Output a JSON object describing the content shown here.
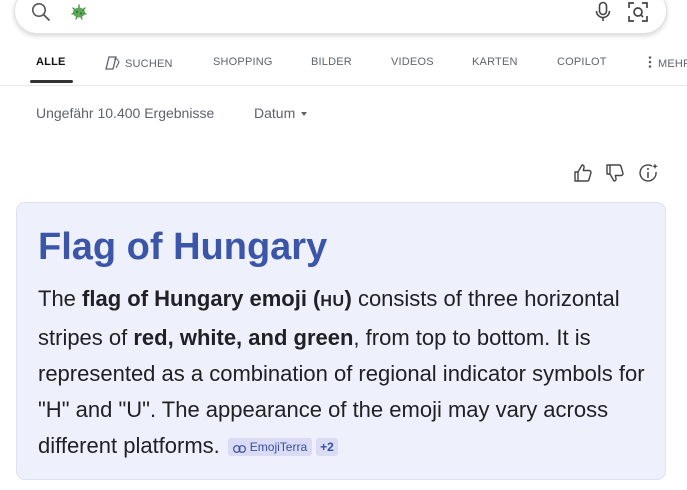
{
  "search": {
    "query_icon": "bacterium-emoji-icon",
    "icons": [
      "search-icon",
      "microphone-icon",
      "visual-search-icon"
    ]
  },
  "tabs": [
    {
      "label": "ALLE",
      "active": true
    },
    {
      "label": "SUCHEN",
      "icon": "copilot-search-icon"
    },
    {
      "label": "SHOPPING"
    },
    {
      "label": "BILDER"
    },
    {
      "label": "VIDEOS"
    },
    {
      "label": "KARTEN"
    },
    {
      "label": "COPILOT"
    },
    {
      "label": "MEHR",
      "icon": "more-vertical-icon"
    }
  ],
  "results": {
    "count_text": "Ungefähr 10.400 Ergebnisse",
    "date_filter": "Datum"
  },
  "feedback": {
    "icons": [
      "thumbs-up-icon",
      "thumbs-down-icon",
      "info-sparkle-icon"
    ]
  },
  "answer": {
    "title": "Flag of Hungary",
    "body": {
      "t1": "The ",
      "b1": "flag of Hungary emoji (",
      "b1_code": "HU",
      "b1_end": ")",
      "t2": " consists of three horizontal stripes of ",
      "b2": "red, white, and green",
      "t3": ", from top to bottom. It is represented as a combination of regional indicator symbols for \"H\" and \"U\". The appearance of the emoji may vary across different platforms."
    },
    "citation": {
      "label": "EmojiTerra",
      "icon": "link-icon"
    },
    "more_sources": "+2"
  },
  "colors": {
    "title": "#3b55a8",
    "card_bg": "#eef0fb",
    "chip_bg": "#d9dcf4"
  }
}
